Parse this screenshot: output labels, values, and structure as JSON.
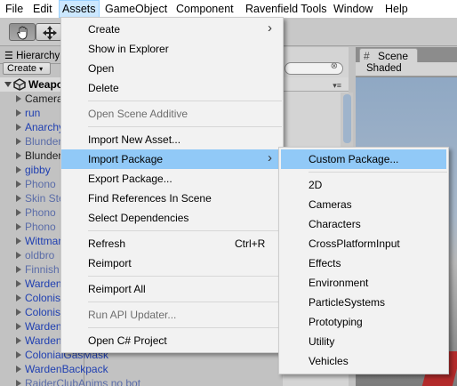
{
  "menubar": {
    "items": [
      "File",
      "Edit",
      "Assets",
      "GameObject",
      "Component",
      "Ravenfield Tools",
      "Window",
      "Help"
    ],
    "active": "Assets"
  },
  "toolbar": {
    "tools": [
      {
        "icon": "hand-tool-icon",
        "pressed": true
      },
      {
        "icon": "move-tool-icon",
        "pressed": false
      }
    ]
  },
  "hierarchy": {
    "tab_label": "Hierarchy",
    "create_label": "Create",
    "scene_root": "Weapons",
    "items": [
      {
        "label": "Camera",
        "style": "dark"
      },
      {
        "label": "run",
        "style": "blue"
      },
      {
        "label": "Anarchy",
        "style": "blue"
      },
      {
        "label": "Blunderbuss",
        "style": "faded"
      },
      {
        "label": "Blunderbuss",
        "style": "dark"
      },
      {
        "label": "gibby",
        "style": "blue"
      },
      {
        "label": "Phono",
        "style": "faded"
      },
      {
        "label": "Skin Stealer",
        "style": "faded"
      },
      {
        "label": "Phono",
        "style": "faded"
      },
      {
        "label": "Phono",
        "style": "faded"
      },
      {
        "label": "Wittman",
        "style": "blue"
      },
      {
        "label": "oldbro",
        "style": "faded"
      },
      {
        "label": "Finnish",
        "style": "faded"
      },
      {
        "label": "Warden",
        "style": "blue"
      },
      {
        "label": "Colonist",
        "style": "blue"
      },
      {
        "label": "Colonist",
        "style": "blue"
      },
      {
        "label": "Warden",
        "style": "blue"
      },
      {
        "label": "Warden",
        "style": "blue"
      },
      {
        "label": "ColonialGasMask",
        "style": "blue"
      },
      {
        "label": "WardenBackpack",
        "style": "blue"
      },
      {
        "label": "RaiderClubAnims no bot",
        "style": "faded"
      }
    ]
  },
  "scene": {
    "tab_label": "Scene",
    "shading_label": "Shaded"
  },
  "assets_menu": {
    "items": [
      {
        "label": "Create",
        "submenu": true
      },
      {
        "label": "Show in Explorer"
      },
      {
        "label": "Open"
      },
      {
        "label": "Delete"
      },
      {
        "separator": true
      },
      {
        "label": "Open Scene Additive",
        "disabled": true
      },
      {
        "separator": true
      },
      {
        "label": "Import New Asset..."
      },
      {
        "label": "Import Package",
        "submenu": true,
        "highlighted": true
      },
      {
        "label": "Export Package..."
      },
      {
        "label": "Find References In Scene"
      },
      {
        "label": "Select Dependencies"
      },
      {
        "separator": true
      },
      {
        "label": "Refresh",
        "shortcut": "Ctrl+R"
      },
      {
        "label": "Reimport"
      },
      {
        "separator": true
      },
      {
        "label": "Reimport All"
      },
      {
        "separator": true
      },
      {
        "label": "Run API Updater...",
        "disabled": true
      },
      {
        "separator": true
      },
      {
        "label": "Open C# Project"
      }
    ],
    "submenu_arrow": "›"
  },
  "import_package_menu": {
    "items": [
      {
        "label": "Custom Package...",
        "highlighted": true
      },
      {
        "separator": true
      },
      {
        "label": "2D"
      },
      {
        "label": "Cameras"
      },
      {
        "label": "Characters"
      },
      {
        "label": "CrossPlatformInput"
      },
      {
        "label": "Effects"
      },
      {
        "label": "Environment"
      },
      {
        "label": "ParticleSystems"
      },
      {
        "label": "Prototyping"
      },
      {
        "label": "Utility"
      },
      {
        "label": "Vehicles"
      }
    ]
  },
  "colors": {
    "menu_highlight": "#91c9f7",
    "menubar_active": "#cce8ff",
    "hierarchy_prefab_text": "#1f3fb1"
  }
}
